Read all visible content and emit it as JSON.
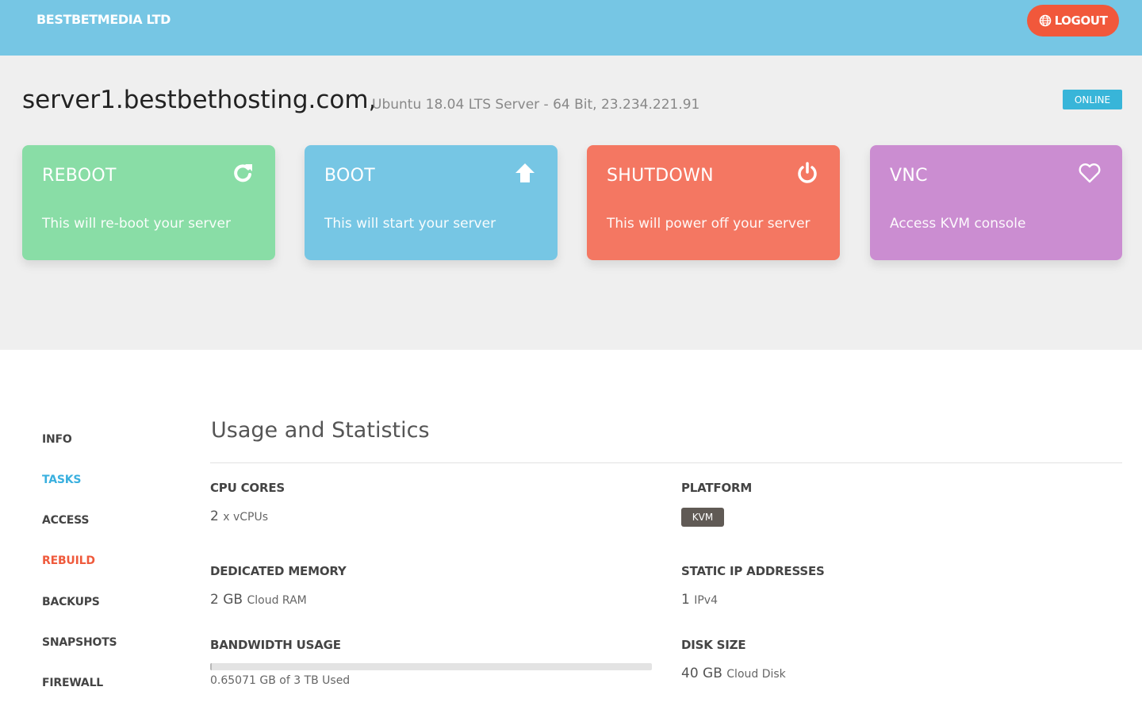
{
  "header": {
    "brand": "BESTBETMEDIA LTD",
    "logout_label": "LOGOUT",
    "logout_icon": "globe-icon"
  },
  "server": {
    "hostname": "server1.bestbethosting.com,",
    "details": "Ubuntu 18.04 LTS Server - 64 Bit, 23.234.221.91",
    "status": "ONLINE"
  },
  "actions": [
    {
      "title": "REBOOT",
      "desc": "This will re-boot your server",
      "icon": "refresh-icon",
      "color": "#89dda6"
    },
    {
      "title": "BOOT",
      "desc": "This will start your server",
      "icon": "arrow-up-icon",
      "color": "#76c6e4"
    },
    {
      "title": "SHUTDOWN",
      "desc": "This will power off your server",
      "icon": "power-icon",
      "color": "#f47762"
    },
    {
      "title": "VNC",
      "desc": "Access KVM console",
      "icon": "heart-icon",
      "color": "#cb8dd1"
    }
  ],
  "sidebar": {
    "items": [
      {
        "label": "INFO"
      },
      {
        "label": "TASKS"
      },
      {
        "label": "ACCESS"
      },
      {
        "label": "REBUILD"
      },
      {
        "label": "BACKUPS"
      },
      {
        "label": "SNAPSHOTS"
      },
      {
        "label": "FIREWALL"
      }
    ]
  },
  "stats": {
    "title": "Usage and Statistics",
    "cpu": {
      "label": "CPU CORES",
      "value": "2",
      "unit": "x vCPUs"
    },
    "platform": {
      "label": "PLATFORM",
      "badge": "KVM"
    },
    "memory": {
      "label": "DEDICATED MEMORY",
      "value": "2 GB",
      "unit": "Cloud RAM"
    },
    "ips": {
      "label": "STATIC IP ADDRESSES",
      "value": "1",
      "unit": "IPv4"
    },
    "bandwidth": {
      "label": "BANDWIDTH USAGE",
      "text": "0.65071 GB of 3 TB Used",
      "used_fraction": 0.0002
    },
    "disk": {
      "label": "DISK SIZE",
      "value": "40 GB",
      "unit": "Cloud Disk"
    }
  },
  "colors": {
    "topbar": "#76c6e4",
    "logout": "#f1583b",
    "online": "#38b5d9",
    "active_link": "#3ab0df",
    "danger_link": "#ef5a3c"
  }
}
